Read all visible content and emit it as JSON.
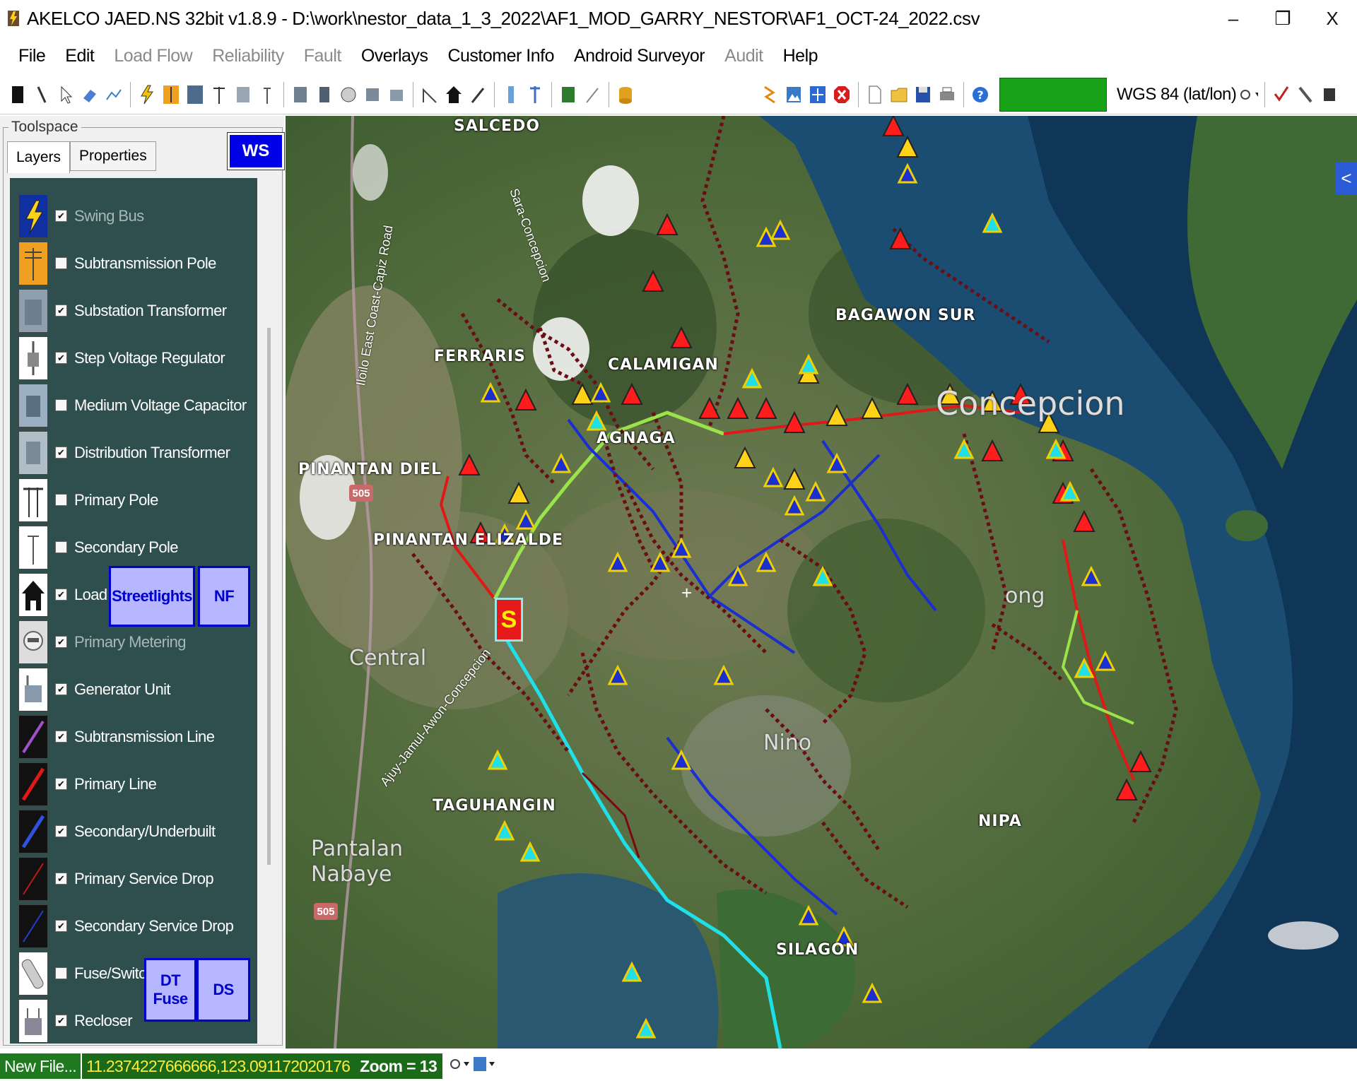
{
  "window": {
    "title": "AKELCO JAED.NS 32bit v1.8.9 - D:\\work\\nestor_data_1_3_2022\\AF1_MOD_GARRY_NESTOR\\AF1_OCT-24_2022.csv",
    "minimize": "–",
    "restore": "❐",
    "close": "X"
  },
  "menu": [
    {
      "label": "File",
      "enabled": true
    },
    {
      "label": "Edit",
      "enabled": true
    },
    {
      "label": "Load Flow",
      "enabled": false
    },
    {
      "label": "Reliability",
      "enabled": false
    },
    {
      "label": "Fault",
      "enabled": false
    },
    {
      "label": "Overlays",
      "enabled": true
    },
    {
      "label": "Customer Info",
      "enabled": true
    },
    {
      "label": "Android Surveyor",
      "enabled": true
    },
    {
      "label": "Audit",
      "enabled": false
    },
    {
      "label": "Help",
      "enabled": true
    }
  ],
  "toolbar": {
    "crs_label": "WGS 84 (lat/lon)",
    "status_color": "#18a318"
  },
  "toolspace": {
    "title": "Toolspace",
    "tabs": [
      "Layers",
      "Properties"
    ],
    "ws_button": "WS",
    "layers": [
      {
        "label": "Swing Bus",
        "checked": true,
        "enabled": false,
        "icon": "lightning-icon"
      },
      {
        "label": "Subtransmission Pole",
        "checked": false,
        "enabled": true,
        "icon": "subtransmission-pole-icon"
      },
      {
        "label": "Substation Transformer",
        "checked": true,
        "enabled": true,
        "icon": "substation-transformer-icon"
      },
      {
        "label": "Step Voltage Regulator",
        "checked": true,
        "enabled": true,
        "icon": "voltage-regulator-icon"
      },
      {
        "label": "Medium Voltage Capacitor",
        "checked": false,
        "enabled": true,
        "icon": "capacitor-icon"
      },
      {
        "label": "Distribution Transformer",
        "checked": true,
        "enabled": true,
        "icon": "distribution-transformer-icon"
      },
      {
        "label": "Primary Pole",
        "checked": false,
        "enabled": true,
        "icon": "primary-pole-icon"
      },
      {
        "label": "Secondary Pole",
        "checked": false,
        "enabled": true,
        "icon": "secondary-pole-icon"
      },
      {
        "label": "Load",
        "checked": true,
        "enabled": true,
        "icon": "house-icon"
      },
      {
        "label": "Primary Metering",
        "checked": true,
        "enabled": false,
        "icon": "meter-icon"
      },
      {
        "label": "Generator Unit",
        "checked": true,
        "enabled": true,
        "icon": "generator-icon"
      },
      {
        "label": "Subtransmission Line",
        "checked": true,
        "enabled": true,
        "icon": "purple-line-icon"
      },
      {
        "label": "Primary Line",
        "checked": true,
        "enabled": true,
        "icon": "red-line-icon"
      },
      {
        "label": "Secondary/Underbuilt",
        "checked": true,
        "enabled": true,
        "icon": "blue-line-icon"
      },
      {
        "label": "Primary Service Drop",
        "checked": true,
        "enabled": true,
        "icon": "thin-red-line-icon"
      },
      {
        "label": "Secondary Service Drop",
        "checked": true,
        "enabled": true,
        "icon": "thin-blue-line-icon"
      },
      {
        "label": "Fuse/Switch",
        "checked": false,
        "enabled": true,
        "icon": "fuse-icon"
      },
      {
        "label": "Recloser",
        "checked": true,
        "enabled": true,
        "icon": "recloser-icon"
      }
    ],
    "buttons": {
      "streetlights": "Streetlights",
      "nf": "NF",
      "dt_fuse": "DT Fuse",
      "ds": "DS"
    }
  },
  "map": {
    "labels": {
      "salcedo": "SALCEDO",
      "ferraris": "FERRARIS",
      "calamigan": "CALAMIGAN",
      "agnaga": "AGNAGA",
      "bagawon": "BAGAWON SUR",
      "pinantan_diel": "PINANTAN DIEL",
      "pinantan_elizalde": "PINANTAN ELIZALDE",
      "central": "Central",
      "concepcion": "Concepcion",
      "nino": "Nino",
      "taguhangin": "TAGUHANGIN",
      "nipa": "NIPA",
      "pantalan": "Pantalan Nabaye",
      "silagon": "SILAGON",
      "ong": "ong"
    },
    "roads": {
      "iloilo_capiz": "Iloilo East Coast-Capiz Road",
      "sara_conc": "Sara-Concepcion",
      "ajuy": "Ajuy-Jamul-Awon-Concepcion"
    },
    "highway_badge": "505",
    "substation_symbol": "S",
    "collapse": "<"
  },
  "statusbar": {
    "file": "New File...",
    "coords": "11.2374227666666,123.091172020176",
    "zoom": "Zoom = 13"
  }
}
